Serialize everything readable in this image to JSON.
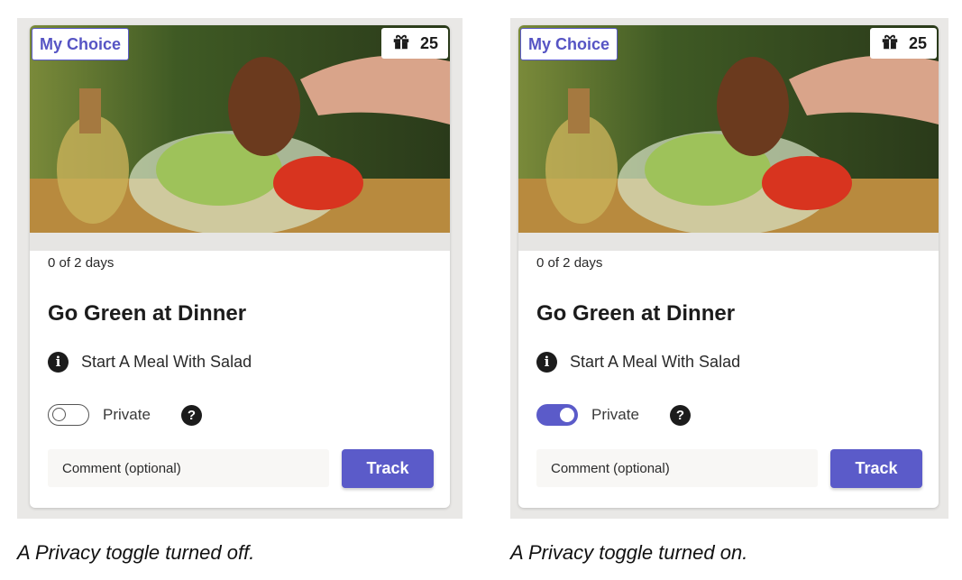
{
  "cards": [
    {
      "badge": "My Choice",
      "points": "25",
      "progress": "0 of 2 days",
      "title": "Go Green at Dinner",
      "tip": "Start A Meal With Salad",
      "privacy_label": "Private",
      "privacy_on": false,
      "comment_placeholder": "Comment (optional)",
      "track_label": "Track",
      "caption": "A Privacy toggle turned off."
    },
    {
      "badge": "My Choice",
      "points": "25",
      "progress": "0 of 2 days",
      "title": "Go Green at Dinner",
      "tip": "Start A Meal With Salad",
      "privacy_label": "Private",
      "privacy_on": true,
      "comment_placeholder": "Comment (optional)",
      "track_label": "Track",
      "caption": "A Privacy toggle turned on."
    }
  ],
  "icons": {
    "points": "gift-icon",
    "tip": "info-icon",
    "help": "question-icon"
  },
  "colors": {
    "accent": "#5b5bc9",
    "panel_bg": "#e9e8e6",
    "comment_bg": "#f8f7f5"
  }
}
